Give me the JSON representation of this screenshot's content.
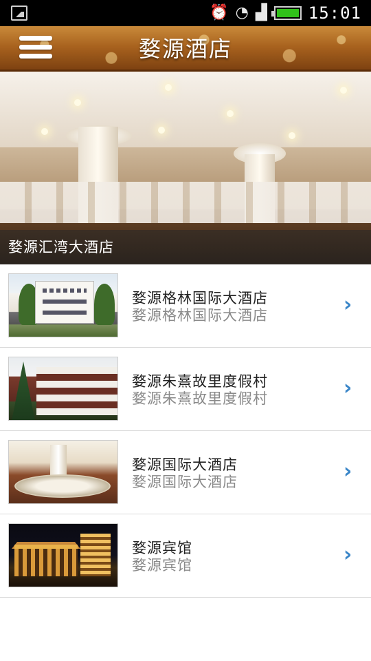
{
  "status_bar": {
    "time": "15:01",
    "icons": [
      "image-icon",
      "alarm-icon",
      "wifi-icon",
      "signal-icon",
      "battery-icon"
    ]
  },
  "header": {
    "title": "婺源酒店",
    "menu_icon": "hamburger-menu-icon"
  },
  "banner": {
    "caption": "婺源汇湾大酒店"
  },
  "hotels": [
    {
      "name": "婺源格林国际大酒店",
      "subtitle": "婺源格林国际大酒店"
    },
    {
      "name": "婺源朱熹故里度假村",
      "subtitle": "婺源朱熹故里度假村"
    },
    {
      "name": "婺源国际大酒店",
      "subtitle": "婺源国际大酒店"
    },
    {
      "name": "婺源宾馆",
      "subtitle": "婺源宾馆"
    }
  ],
  "colors": {
    "accent_chevron": "#3a86c8",
    "title_bar": "#a8621e",
    "battery": "#31c11a"
  }
}
